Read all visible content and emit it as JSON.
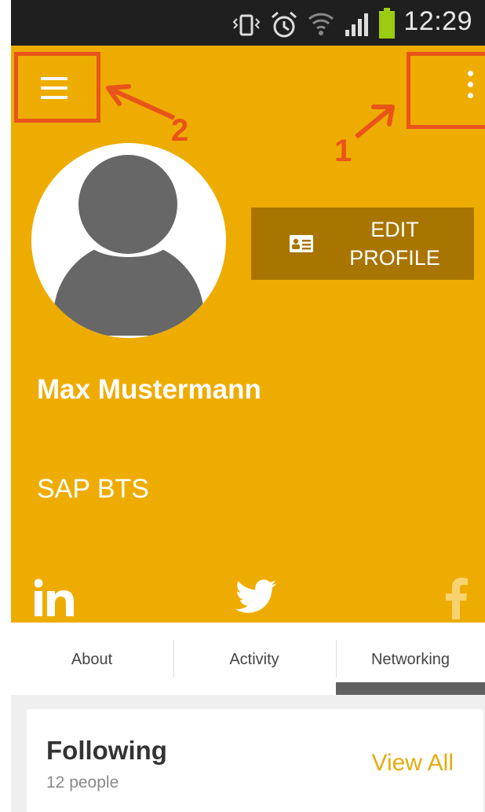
{
  "status_bar": {
    "time": "12:29",
    "icons": [
      "vibrate-icon",
      "alarm-icon",
      "wifi-icon",
      "signal-icon",
      "battery-icon"
    ]
  },
  "header": {
    "menu_icon": "hamburger-menu-icon",
    "overflow_icon": "overflow-menu-icon",
    "edit_profile_label_line1": "EDIT",
    "edit_profile_label_line2": "PROFILE",
    "edit_profile_icon": "id-card-icon",
    "name": "Max Mustermann",
    "company": "SAP BTS",
    "social": [
      "linkedin-icon",
      "twitter-icon",
      "facebook-icon"
    ]
  },
  "annotations": {
    "callout_1": "1",
    "callout_2": "2",
    "color": "#e8541a"
  },
  "tabs": [
    {
      "label": "About"
    },
    {
      "label": "Activity"
    },
    {
      "label": "Networking",
      "selected": true
    }
  ],
  "following": {
    "title": "Following",
    "count": "12 people",
    "action": "View All"
  },
  "colors": {
    "accent": "#eeac00",
    "edit_button": "#a87500",
    "tab_indicator": "#616161",
    "link": "#e6ab10"
  }
}
